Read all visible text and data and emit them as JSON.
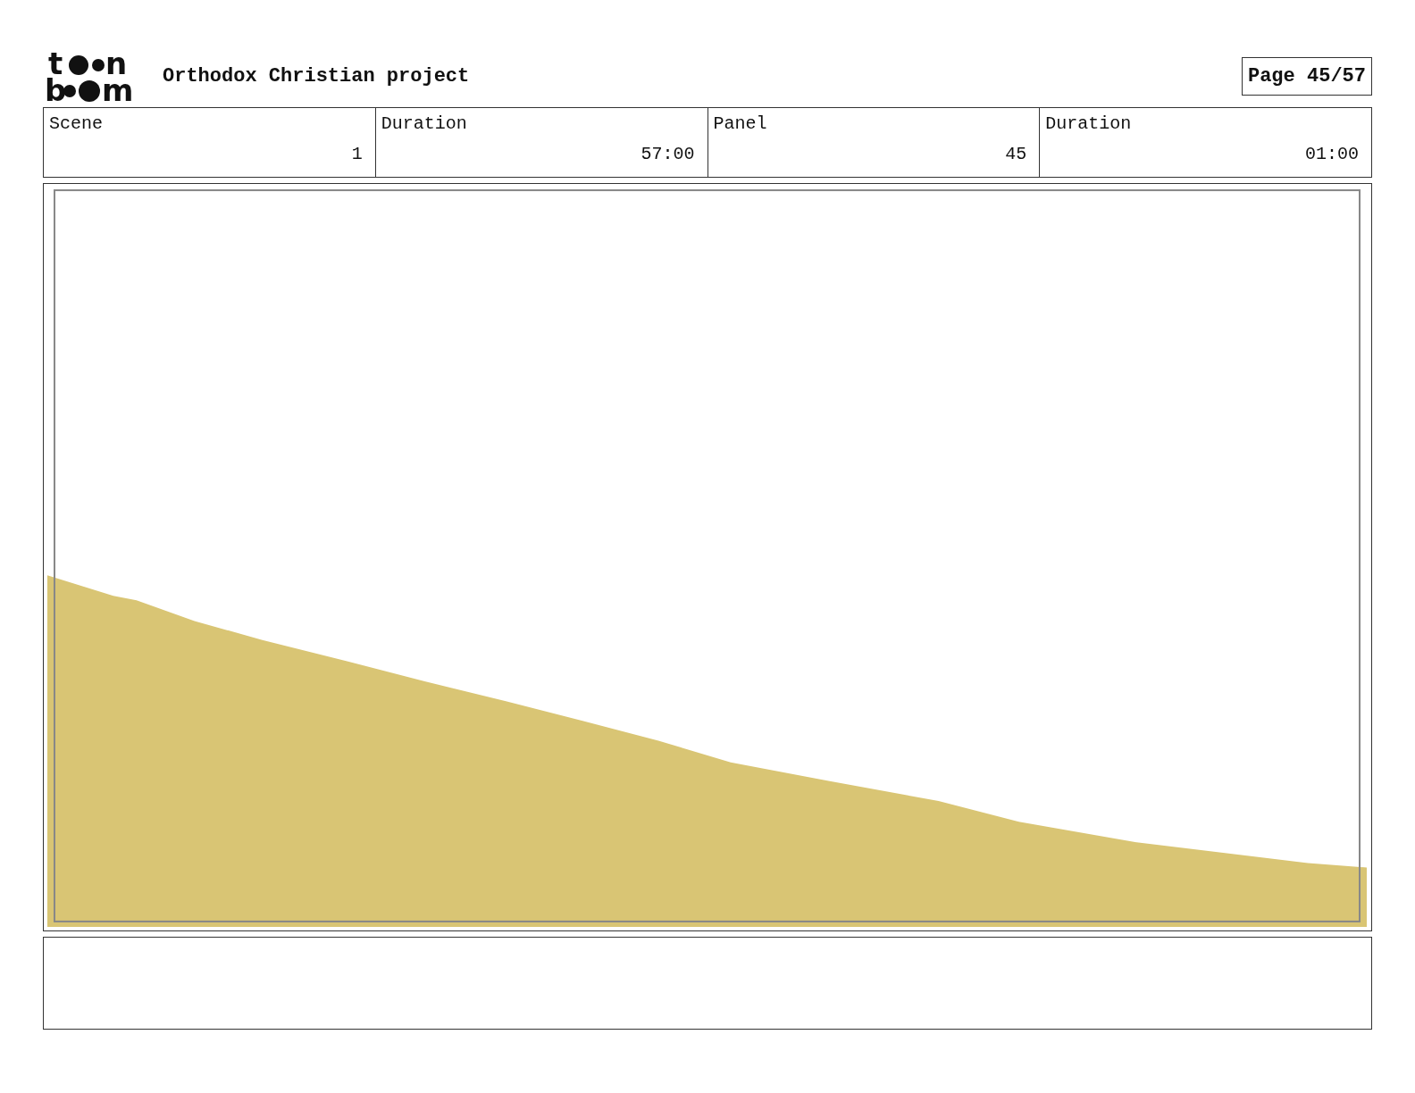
{
  "logo": {
    "top_start": "t",
    "top_end": "n",
    "bottom_start": "b",
    "bottom_end": "m"
  },
  "project_title": "Orthodox Christian project",
  "page_indicator": "Page 45/57",
  "info_fields": [
    {
      "label": "Scene",
      "value": "1"
    },
    {
      "label": "Duration",
      "value": "57:00"
    },
    {
      "label": "Panel",
      "value": "45"
    },
    {
      "label": "Duration",
      "value": "01:00"
    }
  ]
}
